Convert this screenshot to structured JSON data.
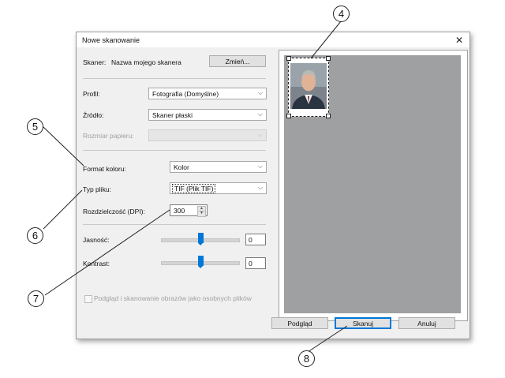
{
  "dialog": {
    "title": "Nowe skanowanie",
    "close_glyph": "✕",
    "scanner_label": "Skaner:",
    "scanner_name": "Nazwa mojego skanera",
    "change_button": "Zmień...",
    "profile_label": "Profil:",
    "profile_value": "Fotografia (Domyślne)",
    "source_label": "Źródło:",
    "source_value": "Skaner płaski",
    "paper_size_label": "Rozmiar papieru:",
    "paper_size_value": "",
    "color_format_label": "Format koloru:",
    "color_format_value": "Kolor",
    "file_type_label": "Typ pliku:",
    "file_type_value": "TIF (Plik TIF)",
    "resolution_label": "Rozdzielczość (DPI):",
    "resolution_value": "300",
    "brightness_label": "Jasność:",
    "brightness_value": "0",
    "contrast_label": "Kontrast:",
    "contrast_value": "0",
    "separate_files_label": "Podgląd i skanowanie obrazów jako osobnych plików",
    "separate_files_checked": false,
    "preview_button": "Podgląd",
    "scan_button": "Skanuj",
    "cancel_button": "Anuluj"
  },
  "callouts": [
    "4",
    "5",
    "6",
    "7",
    "8"
  ],
  "colors": {
    "accent": "#0078d7",
    "preview_bg": "#9ea0a2"
  }
}
